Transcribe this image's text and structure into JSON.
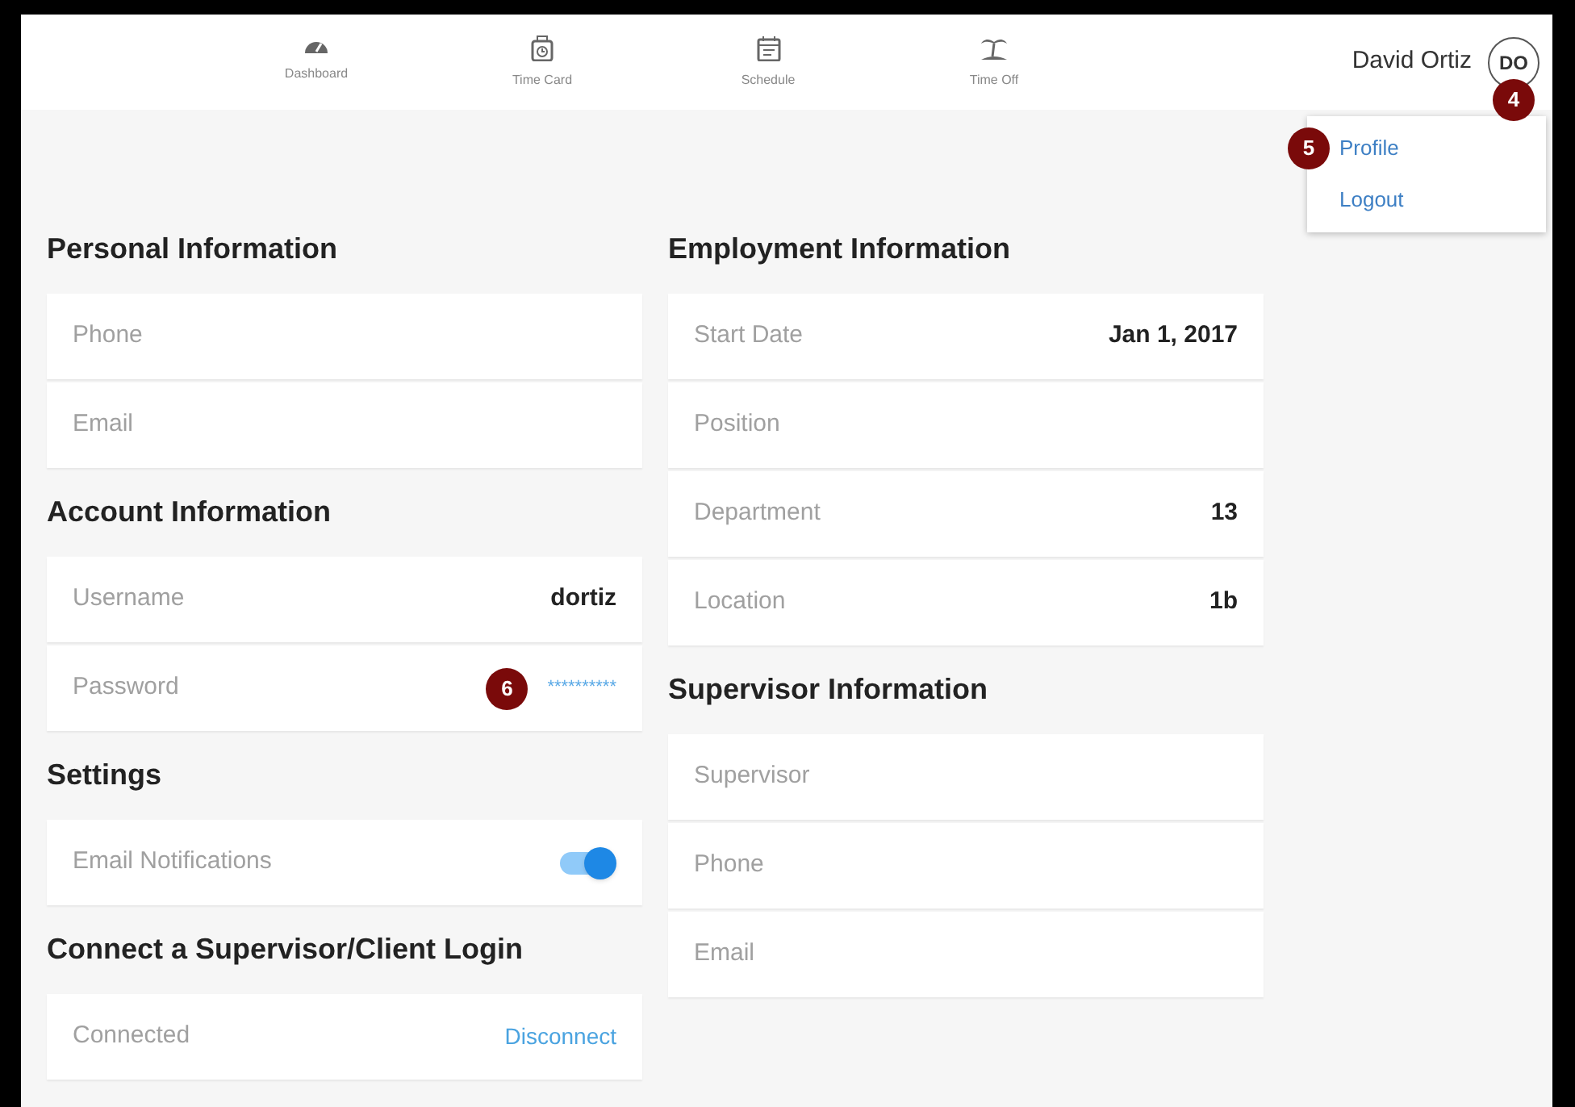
{
  "nav": [
    {
      "label": "Dashboard",
      "kind": "gauge",
      "selected": false
    },
    {
      "label": "Time Card",
      "kind": "timecard",
      "selected": false
    },
    {
      "label": "Schedule",
      "kind": "calendar",
      "selected": false
    },
    {
      "label": "Time Off",
      "kind": "palm",
      "selected": false
    }
  ],
  "user": {
    "name": "David Ortiz",
    "initials": "DO",
    "callout": "4"
  },
  "user_menu": {
    "items": [
      {
        "label": "Profile",
        "callout": "5"
      },
      {
        "label": "Logout"
      }
    ]
  },
  "columns": [
    [
      {
        "title": "Personal Information",
        "rows": [
          {
            "kind": "field",
            "label": "Phone"
          },
          {
            "kind": "field",
            "label": "Email"
          }
        ]
      },
      {
        "title": "Account Information",
        "rows": [
          {
            "kind": "field",
            "label": "Username",
            "value": "dortiz"
          },
          {
            "kind": "password",
            "label": "Password",
            "value": "**********",
            "callout": "6"
          }
        ]
      },
      {
        "title": "Settings",
        "rows": [
          {
            "kind": "toggle",
            "label": "Email Notifications",
            "on": true
          }
        ]
      },
      {
        "title": "Connect a Supervisor/Client Login",
        "rows": [
          {
            "kind": "link",
            "label": "Connected",
            "value": "Disconnect"
          }
        ]
      }
    ],
    [
      {
        "title": "Employment Information",
        "rows": [
          {
            "kind": "field",
            "label": "Start Date",
            "value": "Jan 1, 2017"
          },
          {
            "kind": "field",
            "label": "Position"
          },
          {
            "kind": "field",
            "label": "Department",
            "value": "13"
          },
          {
            "kind": "field",
            "label": "Location",
            "value": "1b"
          }
        ]
      },
      {
        "title": "Supervisor Information",
        "rows": [
          {
            "kind": "field",
            "label": "Supervisor"
          },
          {
            "kind": "field",
            "label": "Phone"
          },
          {
            "kind": "field",
            "label": "Email"
          }
        ]
      }
    ]
  ]
}
